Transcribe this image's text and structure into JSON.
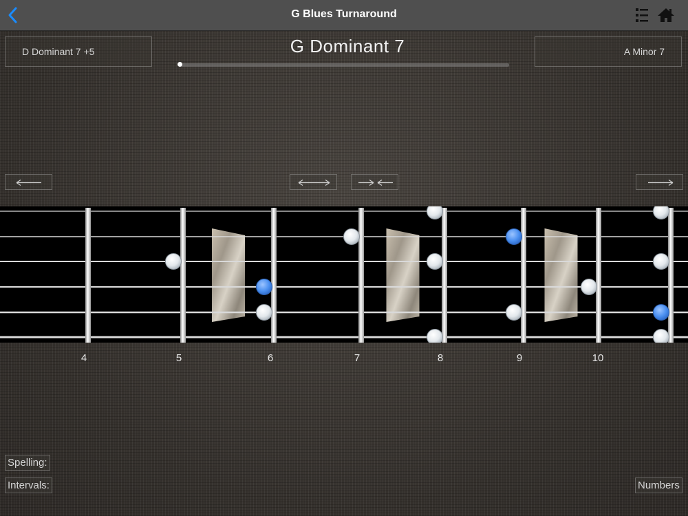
{
  "navbar": {
    "title": "G Blues Turnaround",
    "back_icon": "chevron-left-icon",
    "list_icon": "list-icon",
    "home_icon": "home-icon",
    "accent_color": "#1a8cff"
  },
  "chord_nav": {
    "previous_label": "D  Dominant 7 +5",
    "current_title": "G  Dominant 7",
    "next_label": "A  Minor 7"
  },
  "progress": {
    "fraction": 0.0
  },
  "arrow_buttons": [
    {
      "name": "shift-left-button",
      "icon": "arrow-left-icon"
    },
    {
      "name": "expand-button",
      "icon": "arrows-out-icon"
    },
    {
      "name": "contract-button",
      "icon": "arrows-in-icon"
    },
    {
      "name": "shift-right-button",
      "icon": "arrow-right-icon"
    }
  ],
  "fretboard": {
    "fret_numbers": [
      "4",
      "5",
      "6",
      "7",
      "8",
      "9",
      "10"
    ],
    "inlay_frets": [
      5,
      7,
      9
    ],
    "note_color": "#e8ecef",
    "root_color": "#4a8ff0",
    "notes": [
      {
        "string": 3,
        "fret": 4,
        "root": false
      },
      {
        "string": 4,
        "fret": 5,
        "root": true
      },
      {
        "string": 5,
        "fret": 5,
        "root": false
      },
      {
        "string": 2,
        "fret": 6,
        "root": false
      },
      {
        "string": 1,
        "fret": 7,
        "root": false
      },
      {
        "string": 3,
        "fret": 7,
        "root": false
      },
      {
        "string": 6,
        "fret": 7,
        "root": false
      },
      {
        "string": 2,
        "fret": 8,
        "root": true
      },
      {
        "string": 5,
        "fret": 8,
        "root": false
      },
      {
        "string": 4,
        "fret": 9,
        "root": false
      },
      {
        "string": 1,
        "fret": 10,
        "root": false
      },
      {
        "string": 3,
        "fret": 10,
        "root": false
      },
      {
        "string": 5,
        "fret": 10,
        "root": true
      },
      {
        "string": 6,
        "fret": 10,
        "root": false
      }
    ]
  },
  "bottom": {
    "spelling_label": "Spelling:",
    "intervals_label": "Intervals:",
    "numbers_label": "Numbers"
  }
}
